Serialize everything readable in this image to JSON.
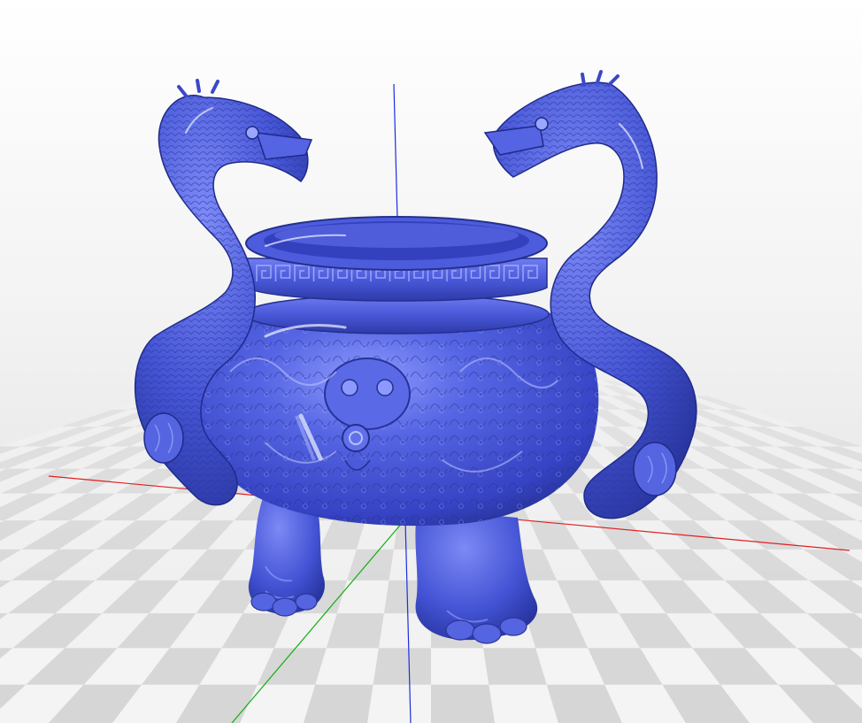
{
  "viewport": {
    "background_top": "#ffffff",
    "background_bottom": "#dedede",
    "grid_light": "#f4f4f4",
    "grid_dark": "#d6d6d6"
  },
  "axes": {
    "x_color": "#e02020",
    "y_color": "#10b010",
    "z_color": "#1a2ee0"
  },
  "model": {
    "icon": "dragon-censer-model",
    "color": "#4757d8",
    "highlight": "#c5ceff",
    "shadow": "#1e2a8c"
  }
}
